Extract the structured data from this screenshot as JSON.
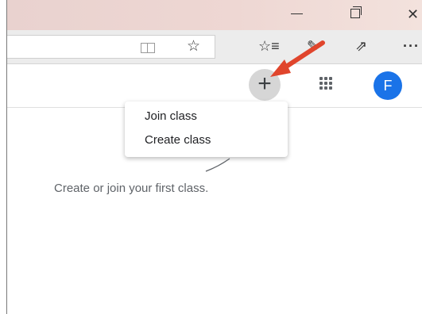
{
  "window_controls": {
    "minimize_icon": "minimize-icon",
    "maximize_icon": "maximize-icon",
    "close_glyph": "✕"
  },
  "toolbar": {
    "icons": [
      "reading-view-icon",
      "star-icon",
      "favorites-icon",
      "pen-icon",
      "share-icon",
      "more-icon"
    ]
  },
  "header": {
    "add_glyph": "+",
    "avatar_letter": "F",
    "avatar_color": "#1a73e8"
  },
  "menu": {
    "items": [
      {
        "label": "Join class"
      },
      {
        "label": "Create class"
      }
    ]
  },
  "main": {
    "empty_message": "Create or join your first class."
  },
  "colors": {
    "annotation_arrow": "#e0452c"
  }
}
